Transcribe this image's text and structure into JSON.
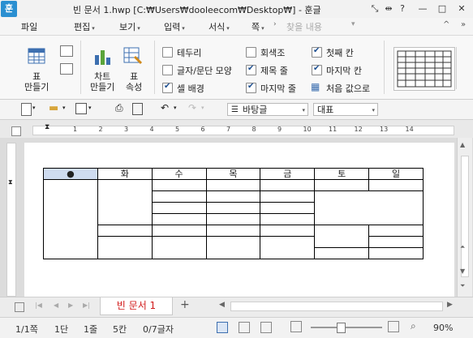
{
  "title_bar": {
    "app_logo": "훈",
    "title": "빈 문서 1.hwp [C:₩Users₩dooleecom₩Desktop₩] - 훈글"
  },
  "menu": {
    "file": "파일",
    "items": [
      {
        "label": "편집"
      },
      {
        "label": "보기"
      },
      {
        "label": "입력"
      },
      {
        "label": "서식"
      },
      {
        "label": "쪽"
      }
    ],
    "search_placeholder": "찾을 내용"
  },
  "ribbon": {
    "table_button": "표\n만들기",
    "chart_button": "차트\n만들기",
    "table_props_button": "표\n속성",
    "options": [
      {
        "label": "테두리",
        "checked": false
      },
      {
        "label": "글자/문단 모양",
        "checked": false
      },
      {
        "label": "셀 배경",
        "checked": true
      },
      {
        "label": "회색조",
        "checked": false
      },
      {
        "label": "제목 줄",
        "checked": true
      },
      {
        "label": "마지막 줄",
        "checked": true
      },
      {
        "label": "첫째 칸",
        "checked": true
      },
      {
        "label": "마지막 칸",
        "checked": true
      }
    ],
    "reset_button": "처음 값으로"
  },
  "toolbar": {
    "style_value": "바탕글",
    "font_value": "대표"
  },
  "ruler_numbers": [
    "1",
    "2",
    "3",
    "4",
    "5",
    "6",
    "7",
    "8",
    "9",
    "10",
    "11",
    "12",
    "13",
    "14"
  ],
  "table": {
    "headers": [
      "●",
      "화",
      "수",
      "목",
      "금",
      "토",
      "일"
    ]
  },
  "tabs": {
    "document": "빈 문서 1",
    "add": "+"
  },
  "status_bar": {
    "page": "1/1쪽",
    "section": "1단",
    "line": "1줄",
    "column": "5칸",
    "chars": "0/7글자",
    "zoom": "90%"
  },
  "colors": {
    "header_first_cell": "#cfdcf0",
    "tab_text": "#d11a1a",
    "app_logo": "#2a8fd1"
  }
}
